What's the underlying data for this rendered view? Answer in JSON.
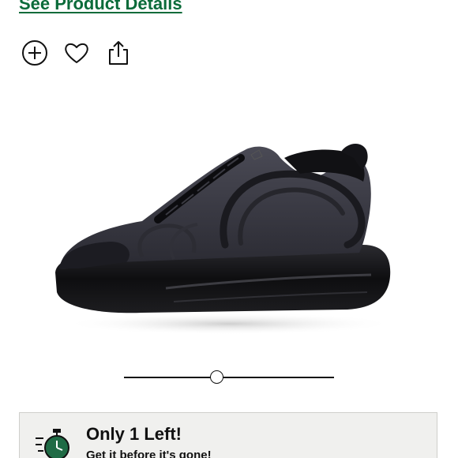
{
  "product": {
    "details_link": "See Product Details",
    "image_alt": "Nike Air Max 720 Black sneaker"
  },
  "actions": [
    {
      "name": "add-to-portfolio",
      "icon": "plus-circle-icon"
    },
    {
      "name": "favorite",
      "icon": "heart-icon"
    },
    {
      "name": "share",
      "icon": "share-icon"
    }
  ],
  "gallery": {
    "slider_position": 0.44
  },
  "stock_banner": {
    "title": "Only 1 Left!",
    "subtitle": "Get it before it's gone!",
    "icon": "stopwatch-icon",
    "icon_color": "#1f6b45"
  },
  "colors": {
    "link": "#0b6b3a",
    "banner_bg": "#f0f0ee"
  }
}
